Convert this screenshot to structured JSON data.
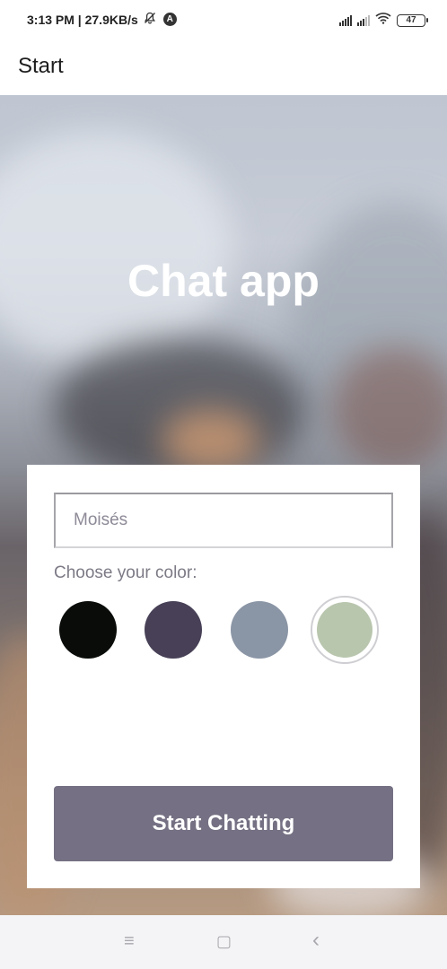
{
  "status_bar": {
    "time_speed": "3:13 PM | 27.9KB/s",
    "bell_icon": "bell-off-icon",
    "app_badge": "A",
    "battery": "47",
    "icons": [
      "signal-icon",
      "signal-icon",
      "wifi-icon",
      "battery-icon"
    ]
  },
  "app_bar": {
    "title": "Start"
  },
  "hero": {
    "title": "Chat app"
  },
  "form": {
    "name_value": "Moisés",
    "color_label": "Choose your color:",
    "colors": [
      "#090C08",
      "#474056",
      "#8A95A5",
      "#B9C6AE"
    ],
    "selected_color": "#B9C6AE",
    "button_label": "Start Chatting",
    "button_color": "#757083"
  },
  "nav_bar": {
    "icons": [
      "menu-icon",
      "home-square-icon",
      "back-chevron-icon"
    ],
    "glyphs": [
      "≡",
      "▢",
      "‹"
    ]
  }
}
